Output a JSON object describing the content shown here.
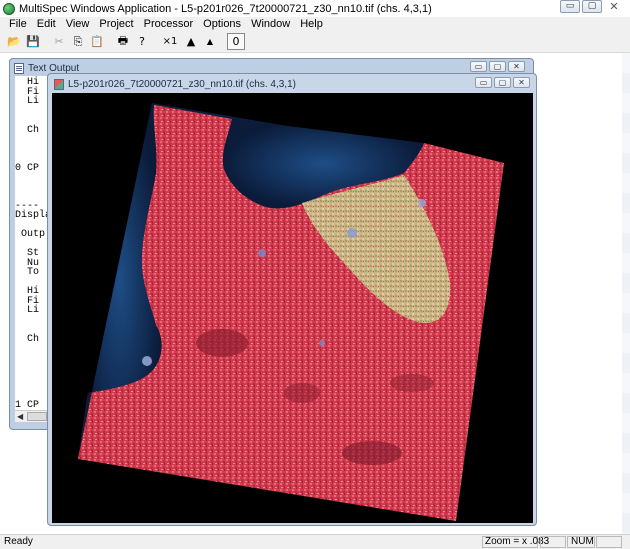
{
  "app": {
    "title": "MultiSpec Windows Application - L5-p201r026_7t20000721_z30_nn10.tif (chs. 4,3,1)"
  },
  "window_controls": {
    "minimize": "▭",
    "maximize": "▢",
    "close": "✕"
  },
  "menu": [
    "File",
    "Edit",
    "View",
    "Project",
    "Processor",
    "Options",
    "Window",
    "Help"
  ],
  "toolbar": {
    "open": "📂",
    "save": "💾",
    "cut": "✂",
    "copy": "⎘",
    "paste": "📋",
    "print": "🖶",
    "help": "?",
    "zoom_x1": "×1",
    "zoom_in": "▲",
    "zoom_out": "▲",
    "overlay": "0"
  },
  "text_output": {
    "title": "Text Output",
    "lines": [
      {
        "t": "  Hi",
        "row": 0
      },
      {
        "t": "  Fi",
        "row": 1
      },
      {
        "t": "  Li",
        "row": 2
      },
      {
        "t": "  Ch",
        "row": 5
      },
      {
        "t": "0 CP",
        "row": 9
      },
      {
        "t": "----",
        "row": 13
      },
      {
        "t": "Displa",
        "row": 14
      },
      {
        "t": " Outp",
        "row": 16
      },
      {
        "t": "  St",
        "row": 18
      },
      {
        "t": "  Nu",
        "row": 19
      },
      {
        "t": "  To",
        "row": 20
      },
      {
        "t": "  Hi",
        "row": 22
      },
      {
        "t": "  Fi",
        "row": 23
      },
      {
        "t": "  Li",
        "row": 24
      },
      {
        "t": "  Ch",
        "row": 27
      },
      {
        "t": "1 CP",
        "row": 34
      },
      {
        "t": " ---",
        "row": 35
      }
    ]
  },
  "image_window": {
    "title": "L5-p201r026_7t20000721_z30_nn10.tif (chs. 4,3,1)"
  },
  "status": {
    "text": "Ready",
    "zoom": "Zoom = x .083",
    "num": "NUM"
  }
}
